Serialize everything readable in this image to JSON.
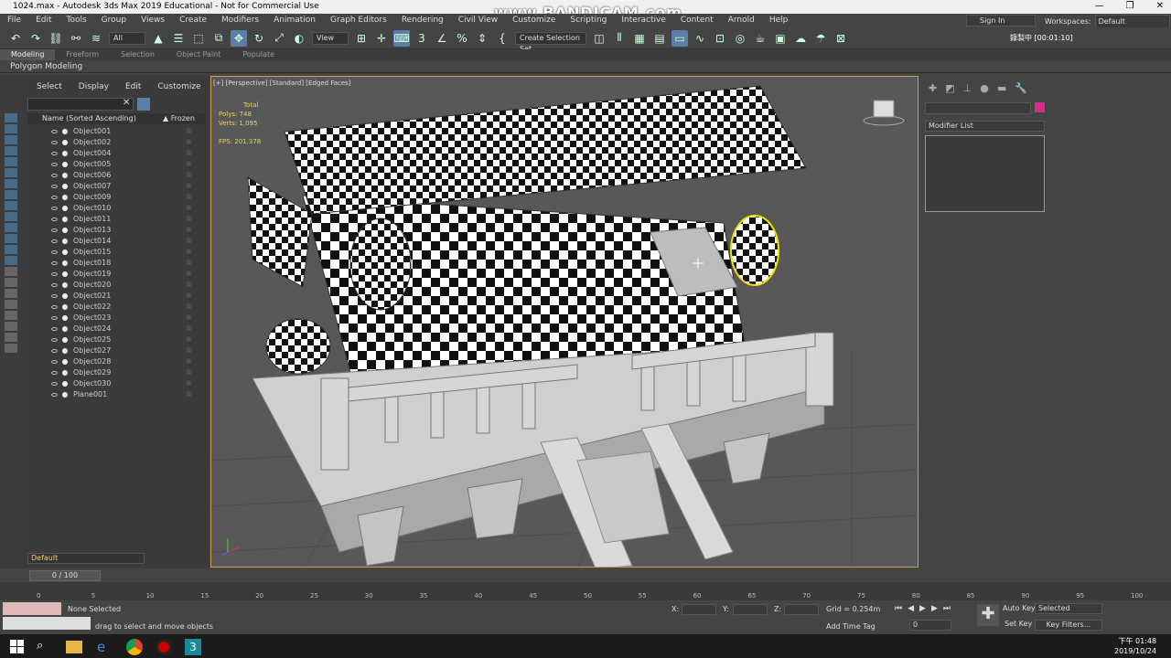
{
  "window": {
    "title": "1024.max - Autodesk 3ds Max 2019 Educational - Not for Commercial Use",
    "watermark": "www.BANDICAM.com",
    "controls": [
      "—",
      "❐",
      "✕"
    ]
  },
  "menu": {
    "items": [
      "File",
      "Edit",
      "Tools",
      "Group",
      "Views",
      "Create",
      "Modifiers",
      "Animation",
      "Graph Editors",
      "Rendering",
      "Civil View",
      "Customize",
      "Scripting",
      "Interactive",
      "Content",
      "Arnold",
      "Help"
    ],
    "sign_in": "Sign In",
    "workspaces_label": "Workspaces:",
    "workspaces_value": "Default"
  },
  "toolbar": {
    "selection_filter": "All",
    "reference_coord": "View",
    "named_selection": "Create Selection Set",
    "recording": "錄製中 [00:01:10]"
  },
  "ribbon": {
    "tabs": [
      "Modeling",
      "Freeform",
      "Selection",
      "Object Paint",
      "Populate"
    ],
    "active_panel": "Polygon Modeling"
  },
  "explorer": {
    "menu": [
      "Select",
      "Display",
      "Edit",
      "Customize"
    ],
    "col_name": "Name (Sorted Ascending)",
    "col_frozen": "▲ Frozen",
    "objects": [
      "Object001",
      "Object002",
      "Object004",
      "Object005",
      "Object006",
      "Object007",
      "Object009",
      "Object010",
      "Object011",
      "Object013",
      "Object014",
      "Object015",
      "Object018",
      "Object019",
      "Object020",
      "Object021",
      "Object022",
      "Object023",
      "Object024",
      "Object025",
      "Object027",
      "Object028",
      "Object029",
      "Object030",
      "Plane001"
    ],
    "layer": "Default"
  },
  "viewport": {
    "label": "[+] [Perspective] [Standard] [Edged Faces]",
    "stats_total": "Total",
    "stats_polys": "Polys:  748",
    "stats_verts": "Verts:  1,095",
    "stats_fps": "FPS:    201.378"
  },
  "command_panel": {
    "modifier_list": "Modifier List",
    "object_color": "#d82a8f"
  },
  "timeline": {
    "frame": "0 / 100",
    "ticks": [
      "0",
      "5",
      "10",
      "15",
      "20",
      "25",
      "30",
      "35",
      "40",
      "45",
      "50",
      "55",
      "60",
      "65",
      "70",
      "75",
      "80",
      "85",
      "90",
      "95",
      "100"
    ]
  },
  "status": {
    "selection": "None Selected",
    "prompt": "drag to select and move objects",
    "x_label": "X:",
    "y_label": "Y:",
    "z_label": "Z:",
    "grid": "Grid = 0.254m",
    "add_time_tag": "Add Time Tag",
    "auto_key": "Auto Key",
    "set_key": "Set Key",
    "key_mode": "Selected",
    "key_filters": "Key Filters...",
    "frame_field": "0"
  },
  "taskbar": {
    "time": "下午 01:48",
    "date": "2019/10/24"
  }
}
